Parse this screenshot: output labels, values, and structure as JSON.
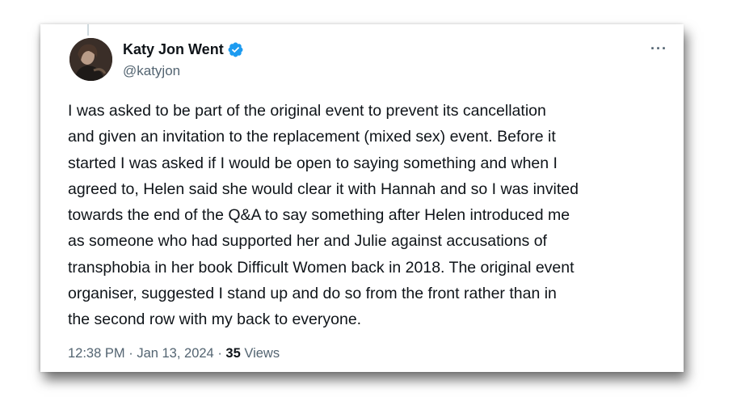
{
  "tweet": {
    "author": {
      "display_name": "Katy Jon Went",
      "handle": "@katyjon",
      "verified": true,
      "avatar": "profile-photo"
    },
    "more_label": "···",
    "text": "I was asked to be part of the original event to prevent its cancellation\nand given an invitation to the replacement (mixed sex) event. Before it\nstarted I was asked if I would be open to saying something and when I\nagreed to, Helen said she would clear it with Hannah and so I was invited\ntowards the end of the Q&A to say something after Helen introduced me\nas someone who had supported her and Julie against accusations of\ntransphobia in her book Difficult Women back in 2018. The original event\norganiser, suggested I stand up and do so from the front rather than in\nthe second row with my back to everyone.",
    "time": "12:38 PM",
    "separator": "·",
    "date": "Jan 13, 2024",
    "views_count": "35",
    "views_label": "Views"
  },
  "colors": {
    "text_primary": "#0f1419",
    "text_secondary": "#536471",
    "verified_blue": "#1d9bf0"
  }
}
